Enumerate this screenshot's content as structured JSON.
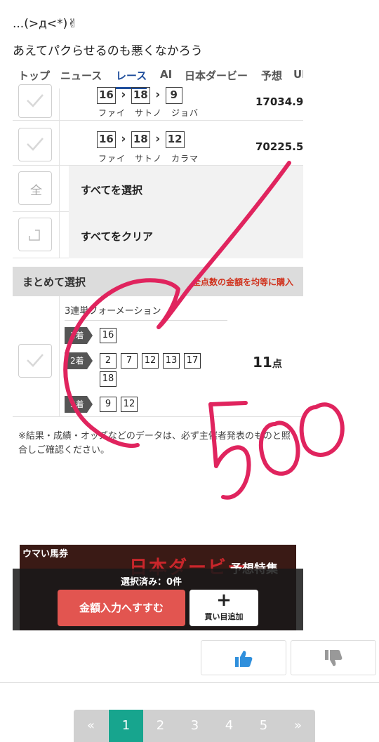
{
  "post": {
    "line1": "...(>д<*)✌",
    "line2": "あえてパクらせるのも悪くなかろう"
  },
  "nav": {
    "tabs": [
      {
        "label": "トップ"
      },
      {
        "label": "ニュース"
      },
      {
        "label": "レース"
      },
      {
        "label": "AI"
      },
      {
        "label": "日本ダービー"
      },
      {
        "label": "予想"
      },
      {
        "label": "UM"
      }
    ],
    "active": "レース"
  },
  "bets": [
    {
      "nums": [
        "16",
        "18",
        "9"
      ],
      "names": "ファイ　サトノ　ジョバ",
      "odds": "17034.9"
    },
    {
      "nums": [
        "16",
        "18",
        "12"
      ],
      "names": "ファイ　サトノ　カラマ",
      "odds": "70225.5"
    }
  ],
  "select_all": {
    "icon_char": "全",
    "label": "すべてを選択"
  },
  "clear_all": {
    "label": "すべてをクリア"
  },
  "matome": {
    "title": "まとめて選択",
    "right": "全点数の金額を均等に購入"
  },
  "formation": {
    "title": "3連単フォーメーション",
    "rows": [
      {
        "label": "1着",
        "nums": [
          "16"
        ]
      },
      {
        "label": "2着",
        "nums": [
          "2",
          "7",
          "12",
          "13",
          "17",
          "18"
        ]
      },
      {
        "label": "3着",
        "nums": [
          "9",
          "12"
        ]
      }
    ],
    "points": "11",
    "points_unit": "点"
  },
  "note": "※結果・成績・オッズなどのデータは、必ず主催者発表のものと照合しご確認ください。",
  "banner": {
    "tag": "ウマい馬券",
    "title": "日本ダービー",
    "subtitle": "予想特集"
  },
  "footer_bar": {
    "selected": "選択済み：0件",
    "amount_button": "金額入力へすすむ",
    "add_button": "買い目追加"
  },
  "handwriting": "500",
  "pagination": {
    "prev": "«",
    "pages": [
      "1",
      "2",
      "3",
      "4",
      "5"
    ],
    "next": "»",
    "current": "1"
  },
  "colors": {
    "accent": "#17a58e",
    "red": "#e25550",
    "ink": "#e0245e",
    "nav_active": "#1f4e9c"
  },
  "icons": [
    "check-icon",
    "clear-icon",
    "thumbs-up-icon",
    "thumbs-down-icon"
  ]
}
